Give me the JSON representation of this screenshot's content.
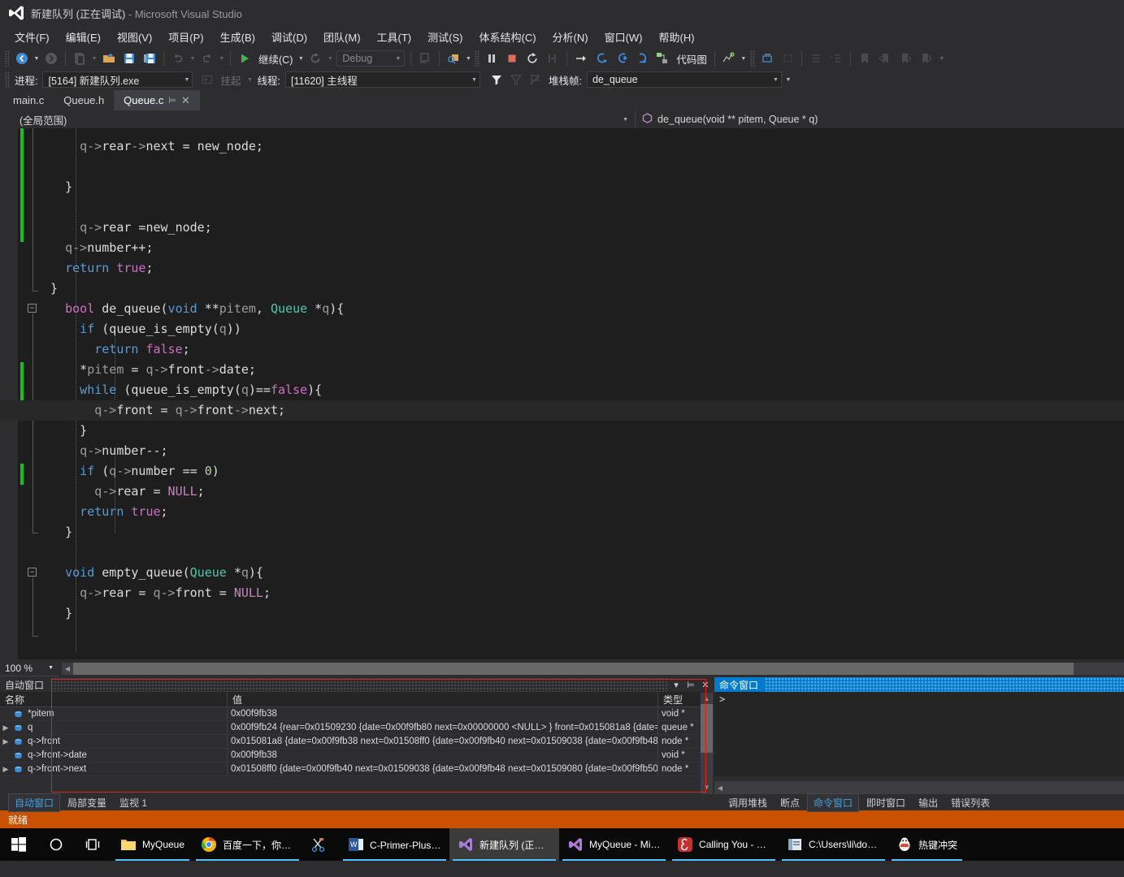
{
  "window": {
    "title_main": "新建队列 (正在调试)",
    "title_suffix": " - Microsoft Visual Studio"
  },
  "menu": [
    {
      "label": "文件(F)"
    },
    {
      "label": "编辑(E)"
    },
    {
      "label": "视图(V)"
    },
    {
      "label": "项目(P)"
    },
    {
      "label": "生成(B)"
    },
    {
      "label": "调试(D)"
    },
    {
      "label": "团队(M)"
    },
    {
      "label": "工具(T)"
    },
    {
      "label": "测试(S)"
    },
    {
      "label": "体系结构(C)"
    },
    {
      "label": "分析(N)"
    },
    {
      "label": "窗口(W)"
    },
    {
      "label": "帮助(H)"
    }
  ],
  "toolbar": {
    "continue_label": "继续(C)",
    "config_value": "Debug",
    "code_map_label": "代码图"
  },
  "debugbar": {
    "process_label": "进程:",
    "process_value": "[5164] 新建队列.exe",
    "suspend_label": "挂起",
    "thread_label": "线程:",
    "thread_value": "[11620] 主线程",
    "stackframe_label": "堆栈帧:",
    "stackframe_value": "de_queue"
  },
  "tabs": [
    {
      "label": "main.c",
      "active": false
    },
    {
      "label": "Queue.h",
      "active": false
    },
    {
      "label": "Queue.c",
      "active": true
    }
  ],
  "navbar": {
    "scope": "(全局范围)",
    "member": "de_queue(void ** pitem, Queue * q)"
  },
  "code": {
    "lines": [
      {
        "indent": 3,
        "tokens": [
          {
            "t": "q->",
            "c": "pl"
          },
          {
            "t": "rear",
            "c": "w"
          },
          {
            "t": "->",
            "c": "pl"
          },
          {
            "t": "next",
            "c": "w"
          },
          {
            "t": " = ",
            "c": "w"
          },
          {
            "t": "new_node;",
            "c": "w"
          }
        ]
      },
      {
        "indent": 0,
        "tokens": []
      },
      {
        "indent": 2,
        "tokens": [
          {
            "t": "}",
            "c": "w"
          }
        ]
      },
      {
        "indent": 0,
        "tokens": []
      },
      {
        "indent": 3,
        "tokens": [
          {
            "t": "q->",
            "c": "pl"
          },
          {
            "t": "rear =new_node;",
            "c": "w"
          }
        ]
      },
      {
        "indent": 2,
        "tokens": [
          {
            "t": "q->",
            "c": "pl"
          },
          {
            "t": "number++;",
            "c": "w"
          }
        ]
      },
      {
        "indent": 2,
        "tokens": [
          {
            "t": "return ",
            "c": "k"
          },
          {
            "t": "true",
            "c": "kb"
          },
          {
            "t": ";",
            "c": "w"
          }
        ]
      },
      {
        "indent": 1,
        "tokens": [
          {
            "t": "}",
            "c": "w"
          }
        ]
      },
      {
        "indent": 2,
        "tokens": [
          {
            "t": "bool ",
            "c": "kb"
          },
          {
            "t": "de_queue",
            "c": "w"
          },
          {
            "t": "(",
            "c": "w"
          },
          {
            "t": "void ",
            "c": "k"
          },
          {
            "t": "**",
            "c": "w"
          },
          {
            "t": "pitem",
            "c": "pl"
          },
          {
            "t": ", ",
            "c": "w"
          },
          {
            "t": "Queue ",
            "c": "ty"
          },
          {
            "t": "*",
            "c": "w"
          },
          {
            "t": "q",
            "c": "pl"
          },
          {
            "t": "){",
            "c": "w"
          }
        ]
      },
      {
        "indent": 3,
        "tokens": [
          {
            "t": "if",
            "c": "k"
          },
          {
            "t": " (",
            "c": "w"
          },
          {
            "t": "queue_is_empty",
            "c": "w"
          },
          {
            "t": "(",
            "c": "w"
          },
          {
            "t": "q",
            "c": "pl"
          },
          {
            "t": "))",
            "c": "w"
          }
        ]
      },
      {
        "indent": 4,
        "tokens": [
          {
            "t": "return ",
            "c": "k"
          },
          {
            "t": "false",
            "c": "kb"
          },
          {
            "t": ";",
            "c": "w"
          }
        ]
      },
      {
        "indent": 3,
        "tokens": [
          {
            "t": "*",
            "c": "w"
          },
          {
            "t": "pitem",
            "c": "pl"
          },
          {
            "t": " = ",
            "c": "w"
          },
          {
            "t": "q->",
            "c": "pl"
          },
          {
            "t": "front",
            "c": "w"
          },
          {
            "t": "->",
            "c": "pl"
          },
          {
            "t": "date;",
            "c": "w"
          }
        ]
      },
      {
        "indent": 3,
        "tokens": [
          {
            "t": "while",
            "c": "k"
          },
          {
            "t": " (",
            "c": "w"
          },
          {
            "t": "queue_is_empty",
            "c": "w"
          },
          {
            "t": "(",
            "c": "w"
          },
          {
            "t": "q",
            "c": "pl"
          },
          {
            "t": ")==",
            "c": "w"
          },
          {
            "t": "false",
            "c": "kb"
          },
          {
            "t": "){",
            "c": "w"
          }
        ]
      },
      {
        "indent": 4,
        "tokens": [
          {
            "t": "q->",
            "c": "pl"
          },
          {
            "t": "front",
            "c": "w"
          },
          {
            "t": " = ",
            "c": "w"
          },
          {
            "t": "q->",
            "c": "pl"
          },
          {
            "t": "front",
            "c": "w"
          },
          {
            "t": "->",
            "c": "pl"
          },
          {
            "t": "next;",
            "c": "w"
          }
        ]
      },
      {
        "indent": 3,
        "tokens": [
          {
            "t": "}",
            "c": "w"
          }
        ]
      },
      {
        "indent": 3,
        "tokens": [
          {
            "t": "q->",
            "c": "pl"
          },
          {
            "t": "number--;",
            "c": "w"
          }
        ]
      },
      {
        "indent": 3,
        "tokens": [
          {
            "t": "if",
            "c": "k"
          },
          {
            "t": " (",
            "c": "w"
          },
          {
            "t": "q->",
            "c": "pl"
          },
          {
            "t": "number",
            "c": "w"
          },
          {
            "t": " == ",
            "c": "w"
          },
          {
            "t": "0",
            "c": "nm"
          },
          {
            "t": ")",
            "c": "w"
          }
        ]
      },
      {
        "indent": 4,
        "tokens": [
          {
            "t": "q->",
            "c": "pl"
          },
          {
            "t": "rear",
            "c": "w"
          },
          {
            "t": " = ",
            "c": "w"
          },
          {
            "t": "NULL",
            "c": "pp"
          },
          {
            "t": ";",
            "c": "w"
          }
        ]
      },
      {
        "indent": 3,
        "tokens": [
          {
            "t": "return ",
            "c": "k"
          },
          {
            "t": "true",
            "c": "kb"
          },
          {
            "t": ";",
            "c": "w"
          }
        ]
      },
      {
        "indent": 2,
        "tokens": [
          {
            "t": "}",
            "c": "w"
          }
        ]
      },
      {
        "indent": 0,
        "tokens": []
      },
      {
        "indent": 2,
        "tokens": [
          {
            "t": "void ",
            "c": "k"
          },
          {
            "t": "empty_queue",
            "c": "w"
          },
          {
            "t": "(",
            "c": "w"
          },
          {
            "t": "Queue ",
            "c": "ty"
          },
          {
            "t": "*",
            "c": "w"
          },
          {
            "t": "q",
            "c": "pl"
          },
          {
            "t": "){",
            "c": "w"
          }
        ]
      },
      {
        "indent": 3,
        "tokens": [
          {
            "t": "q->",
            "c": "pl"
          },
          {
            "t": "rear",
            "c": "w"
          },
          {
            "t": " = ",
            "c": "w"
          },
          {
            "t": "q->",
            "c": "pl"
          },
          {
            "t": "front",
            "c": "w"
          },
          {
            "t": " = ",
            "c": "w"
          },
          {
            "t": "NULL",
            "c": "pp"
          },
          {
            "t": ";",
            "c": "w"
          }
        ]
      },
      {
        "indent": 2,
        "tokens": [
          {
            "t": "}",
            "c": "w"
          }
        ]
      }
    ],
    "current_line_index": 13
  },
  "editor_status": {
    "zoom": "100 %"
  },
  "autos": {
    "title": "自动窗口",
    "columns": [
      "名称",
      "值",
      "类型"
    ],
    "rows": [
      {
        "expandable": false,
        "name": "*pitem",
        "value": "0x00f9fb38",
        "type": "void *"
      },
      {
        "expandable": true,
        "name": "q",
        "value": "0x00f9fb24 {rear=0x01509230 {date=0x00f9fb80 next=0x00000000 <NULL> } front=0x015081a8 {date=",
        "type": "queue *"
      },
      {
        "expandable": true,
        "name": "q->front",
        "value": "0x015081a8 {date=0x00f9fb38 next=0x01508ff0 {date=0x00f9fb40 next=0x01509038 {date=0x00f9fb48",
        "type": "node *"
      },
      {
        "expandable": false,
        "name": "q->front->date",
        "value": "0x00f9fb38",
        "type": "void *"
      },
      {
        "expandable": true,
        "name": "q->front->next",
        "value": "0x01508ff0 {date=0x00f9fb40 next=0x01509038 {date=0x00f9fb48 next=0x01509080 {date=0x00f9fb50",
        "type": "node *"
      }
    ],
    "tabs": [
      {
        "label": "自动窗口",
        "selected": true
      },
      {
        "label": "局部变量",
        "selected": false
      },
      {
        "label": "监视 1",
        "selected": false
      }
    ]
  },
  "command_window": {
    "title": "命令窗口",
    "prompt": ">",
    "tabs": [
      {
        "label": "调用堆栈",
        "selected": false
      },
      {
        "label": "断点",
        "selected": false
      },
      {
        "label": "命令窗口",
        "selected": true
      },
      {
        "label": "即时窗口",
        "selected": false
      },
      {
        "label": "输出",
        "selected": false
      },
      {
        "label": "错误列表",
        "selected": false
      }
    ]
  },
  "statusbar": {
    "text": "就绪"
  },
  "taskbar": {
    "items": [
      {
        "label": "MyQueue",
        "icon": "folder-icon",
        "open": true,
        "active": false
      },
      {
        "label": "百度一下，你就知...",
        "icon": "chrome-icon",
        "open": true,
        "active": false
      },
      {
        "label": "",
        "icon": "snip-icon",
        "open": false,
        "active": false
      },
      {
        "label": "C-Primer-Plus第...",
        "icon": "word-icon",
        "open": true,
        "active": false
      },
      {
        "label": "新建队列 (正在调...",
        "icon": "vs-icon",
        "open": true,
        "active": true
      },
      {
        "label": "MyQueue - Micr...",
        "icon": "vs-icon",
        "open": true,
        "active": false
      },
      {
        "label": "Calling You - Ev...",
        "icon": "netease-icon",
        "open": true,
        "active": false
      },
      {
        "label": "C:\\Users\\li\\docu...",
        "icon": "explorer-icon",
        "open": true,
        "active": false
      },
      {
        "label": "热键冲突",
        "icon": "qq-icon",
        "open": true,
        "active": false
      }
    ]
  },
  "colors": {
    "accent": "#007acc",
    "status_orange": "#ca5100",
    "breakpoint_green": "#18c018",
    "exec_arrow": "#ffd217"
  }
}
